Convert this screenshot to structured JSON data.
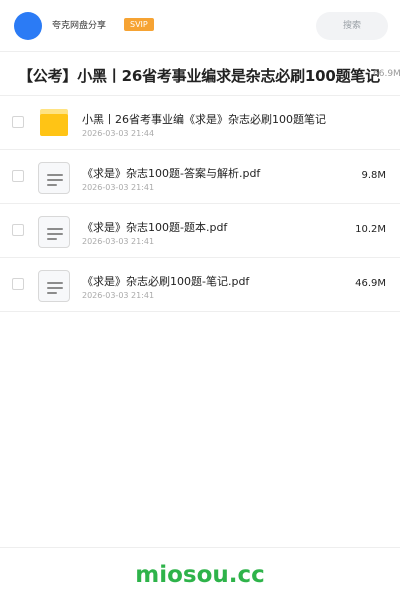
{
  "header": {
    "share_name": "夸克网盘分享",
    "badge": "SVIP",
    "search_placeholder": "搜索"
  },
  "folder": {
    "title": "【公考】小黑丨26省考事业编求是杂志必刷100题笔记",
    "size": "66.9M"
  },
  "files": [
    {
      "name": "小黑丨26省考事业编《求是》杂志必刷100题笔记",
      "date": "2026-03-03 21:44",
      "size": "",
      "type": "folder"
    },
    {
      "name": "《求是》杂志100题-答案与解析.pdf",
      "date": "2026-03-03 21:41",
      "size": "9.8M",
      "type": "pdf"
    },
    {
      "name": "《求是》杂志100题-题本.pdf",
      "date": "2026-03-03 21:41",
      "size": "10.2M",
      "type": "pdf"
    },
    {
      "name": "《求是》杂志必刷100题-笔记.pdf",
      "date": "2026-03-03 21:41",
      "size": "46.9M",
      "type": "pdf"
    }
  ],
  "footer": {
    "brand": "miosou.cc"
  },
  "colors": {
    "avatar": "#2b7bf5",
    "badge": "#f6a333",
    "folder": "#ffc415",
    "brand": "#2eb34a"
  }
}
